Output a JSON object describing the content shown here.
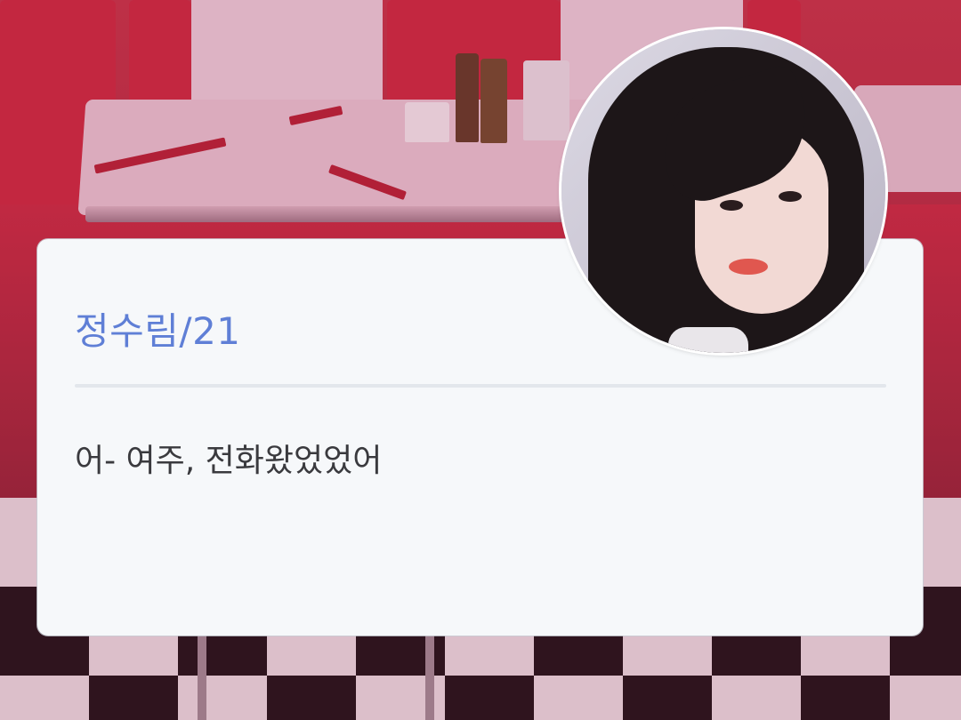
{
  "profile": {
    "name": "정수림/21",
    "message": "어- 여주, 전화왔었었어"
  },
  "colors": {
    "name_text": "#5f7fd6",
    "message_text": "#3a3a3e",
    "card_bg": "#f6f8fa",
    "divider": "#e3e7ec"
  }
}
